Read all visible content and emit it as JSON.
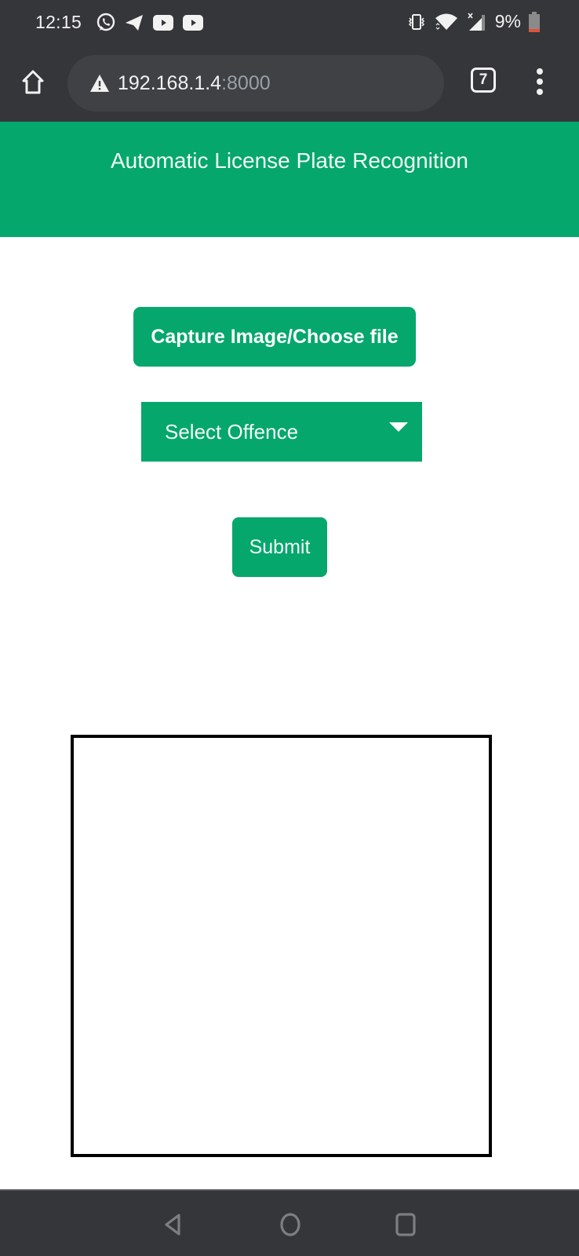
{
  "status_bar": {
    "time": "12:15",
    "notification_icons": [
      "whatsapp-icon",
      "telegram-icon",
      "youtube-icon",
      "youtube-icon"
    ],
    "system_icons": [
      "vibrate-icon",
      "wifi-icon",
      "signal-no-data-icon",
      "battery-low-icon"
    ],
    "battery_percent": "9%",
    "battery_level": 0.09,
    "colors": {
      "battery_low": "#e0533a"
    }
  },
  "browser": {
    "url_host": "192.168.1.4",
    "url_port": ":8000",
    "security_icon": "warning-icon",
    "tab_count": "7"
  },
  "page": {
    "title": "Automatic License Plate Recognition",
    "capture_button_label": "Capture Image/Choose file",
    "offence_select": {
      "selected": "Select Offence"
    },
    "submit_label": "Submit",
    "colors": {
      "accent": "#05a76c"
    }
  },
  "nav_bar": {
    "buttons": [
      "back",
      "home",
      "recents"
    ]
  }
}
